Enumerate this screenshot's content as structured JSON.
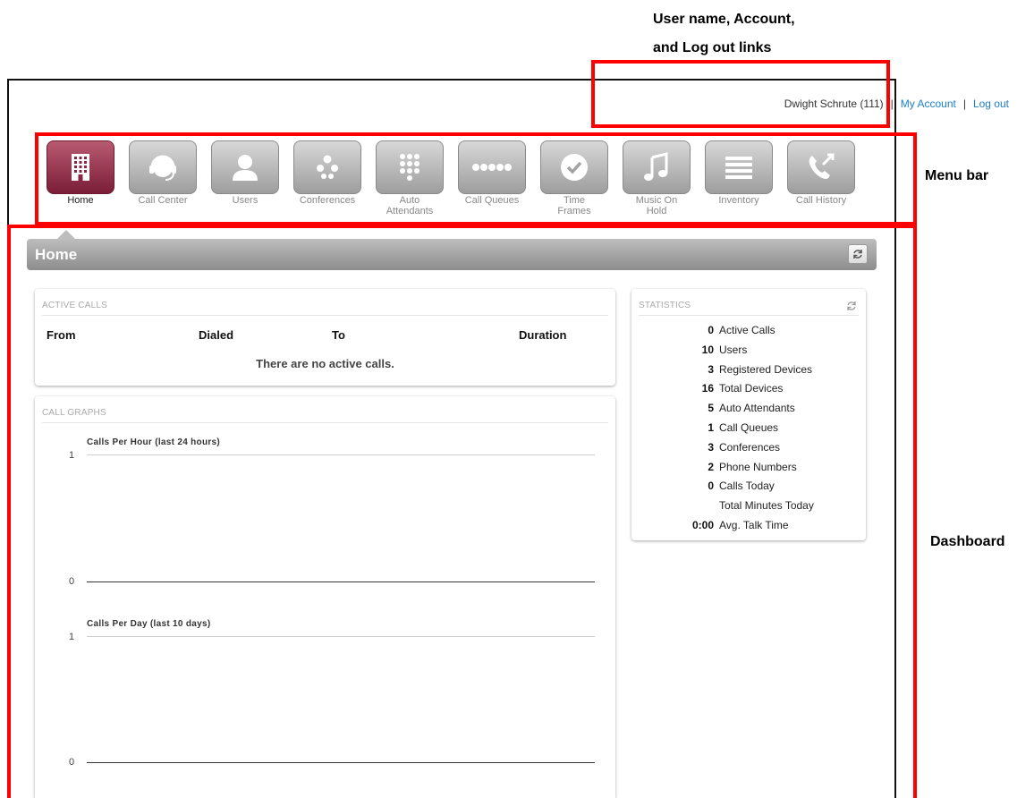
{
  "annotations": {
    "user_links_line1": "User name, Account,",
    "user_links_line2": "and Log out links",
    "menu_bar": "Menu bar",
    "dashboard": "Dashboard"
  },
  "userbar": {
    "user_name": "Dwight Schrute (111)",
    "separator": "|",
    "account_link": "My Account",
    "logout_link": "Log out"
  },
  "menu": {
    "items": [
      {
        "label": "Home",
        "icon": "building-icon",
        "active": true
      },
      {
        "label": "Call Center",
        "icon": "headset-icon"
      },
      {
        "label": "Users",
        "icon": "user-icon"
      },
      {
        "label": "Conferences",
        "icon": "dots-group-icon"
      },
      {
        "label": "Auto Attendants",
        "icon": "keypad-icon"
      },
      {
        "label": "Call Queues",
        "icon": "dots-row-icon"
      },
      {
        "label": "Time Frames",
        "icon": "clock-check-icon"
      },
      {
        "label": "Music On Hold",
        "icon": "music-note-icon"
      },
      {
        "label": "Inventory",
        "icon": "list-lines-icon"
      },
      {
        "label": "Call History",
        "icon": "phone-arrows-icon"
      }
    ],
    "colors": {
      "active": "#8a2440",
      "inactive": "#a8a8a8"
    }
  },
  "page": {
    "title": "Home"
  },
  "active_calls": {
    "title": "ACTIVE CALLS",
    "columns": [
      "From",
      "Dialed",
      "To",
      "Duration"
    ],
    "empty_message": "There are no active calls."
  },
  "call_graphs": {
    "title": "CALL GRAPHS",
    "graphs": [
      {
        "title": "Calls Per Hour (last 24 hours)",
        "y_max_label": "1",
        "y_min_label": "0"
      },
      {
        "title": "Calls Per Day (last 10 days)",
        "y_max_label": "1",
        "y_min_label": "0"
      }
    ]
  },
  "statistics": {
    "title": "STATISTICS",
    "rows": [
      {
        "value": "0",
        "label": "Active Calls"
      },
      {
        "value": "10",
        "label": "Users"
      },
      {
        "value": "3",
        "label": "Registered Devices"
      },
      {
        "value": "16",
        "label": "Total Devices"
      },
      {
        "value": "5",
        "label": "Auto Attendants"
      },
      {
        "value": "1",
        "label": "Call Queues"
      },
      {
        "value": "3",
        "label": "Conferences"
      },
      {
        "value": "2",
        "label": "Phone Numbers"
      },
      {
        "value": "0",
        "label": "Calls Today"
      },
      {
        "value": "",
        "label": "Total Minutes Today"
      },
      {
        "value": "0:00",
        "label": "Avg. Talk Time"
      }
    ]
  }
}
